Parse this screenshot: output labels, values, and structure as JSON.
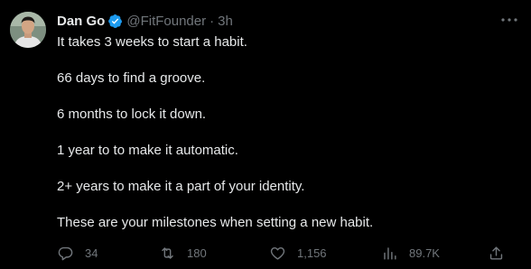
{
  "author": {
    "name": "Dan Go",
    "handle": "@FitFounder",
    "separator": "·",
    "time": "3h",
    "verified": true
  },
  "tweet": {
    "lines": [
      "It takes 3 weeks to start a habit.",
      "66 days to find a groove.",
      "6 months to lock it down.",
      "1 year to to make it automatic.",
      "2+ years to make it a part of your identity.",
      "These are your milestones when setting a new habit."
    ]
  },
  "actions": {
    "replies": "34",
    "retweets": "180",
    "likes": "1,156",
    "views": "89.7K"
  },
  "colors": {
    "background": "#000000",
    "text": "#e7e9ea",
    "secondary": "#71767b",
    "verified": "#1d9bf0"
  },
  "icons": {
    "verified": "verified-badge-icon",
    "more": "more-horizontal-icon",
    "reply": "reply-icon",
    "retweet": "retweet-icon",
    "like": "heart-icon",
    "views": "views-chart-icon",
    "share": "share-icon"
  }
}
